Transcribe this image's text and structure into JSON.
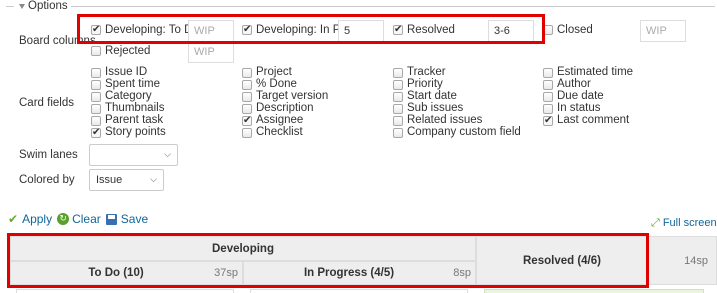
{
  "options": {
    "legend": "Options"
  },
  "board_columns": {
    "label": "Board columns",
    "items": [
      {
        "label": "Developing: To Do",
        "checked": true,
        "wip": "",
        "wip_placeholder": "WIP"
      },
      {
        "label": "Developing: In P…",
        "checked": true,
        "wip": "5",
        "wip_placeholder": "WIP"
      },
      {
        "label": "Resolved",
        "checked": true,
        "wip": "3-6",
        "wip_placeholder": "WIP"
      },
      {
        "label": "Closed",
        "checked": false,
        "wip": "",
        "wip_placeholder": "WIP"
      },
      {
        "label": "Rejected",
        "checked": false,
        "wip": "",
        "wip_placeholder": "WIP"
      }
    ]
  },
  "card_fields": {
    "label": "Card fields",
    "columns": [
      [
        {
          "label": "Issue ID",
          "checked": false
        },
        {
          "label": "Spent time",
          "checked": false
        },
        {
          "label": "Category",
          "checked": false
        },
        {
          "label": "Thumbnails",
          "checked": false
        },
        {
          "label": "Parent task",
          "checked": false
        },
        {
          "label": "Story points",
          "checked": true
        }
      ],
      [
        {
          "label": "Project",
          "checked": false
        },
        {
          "label": "% Done",
          "checked": false
        },
        {
          "label": "Target version",
          "checked": false
        },
        {
          "label": "Description",
          "checked": false
        },
        {
          "label": "Assignee",
          "checked": true
        },
        {
          "label": "Checklist",
          "checked": false
        }
      ],
      [
        {
          "label": "Tracker",
          "checked": false
        },
        {
          "label": "Priority",
          "checked": false
        },
        {
          "label": "Start date",
          "checked": false
        },
        {
          "label": "Sub issues",
          "checked": false
        },
        {
          "label": "Related issues",
          "checked": false
        },
        {
          "label": "Company custom field",
          "checked": false
        }
      ],
      [
        {
          "label": "Estimated time",
          "checked": false
        },
        {
          "label": "Author",
          "checked": false
        },
        {
          "label": "Due date",
          "checked": false
        },
        {
          "label": "In status",
          "checked": false
        },
        {
          "label": "Last comment",
          "checked": true
        }
      ]
    ]
  },
  "swim_lanes": {
    "label": "Swim lanes",
    "value": ""
  },
  "colored_by": {
    "label": "Colored by",
    "value": "Issue"
  },
  "actions": {
    "apply": "Apply",
    "clear": "Clear",
    "save": "Save",
    "full_screen": "Full screen"
  },
  "board": {
    "group_header": "Developing",
    "columns": [
      {
        "title": "To Do (10)",
        "points": "37sp"
      },
      {
        "title": "In Progress (4/5)",
        "points": "8sp"
      },
      {
        "title": "Resolved (4/6)",
        "points": "14sp"
      }
    ]
  },
  "colors": {
    "highlight": "#e00000",
    "link": "#116699",
    "header_bg": "#eeeeee",
    "check_green": "#66aa33"
  }
}
